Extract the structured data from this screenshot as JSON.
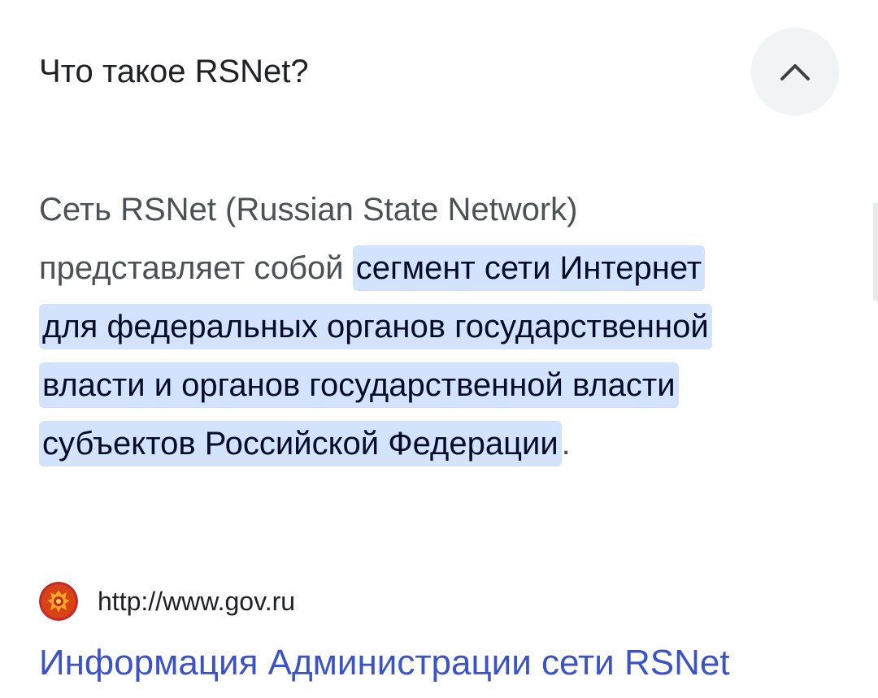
{
  "question": {
    "title": "Что такое RSNet?",
    "toggle_icon": "chevron-up-icon"
  },
  "answer": {
    "lead_text": "Сеть RSNet (Russian State Network) представляет собой ",
    "highlighted_text": "сегмент сети Интернет для федеральных органов государственной власти и органов государственной власти субъектов Российской Федерации",
    "trailing_text": "."
  },
  "source": {
    "favicon": "russian-coat-of-arms-icon",
    "url": "http://www.gov.ru"
  },
  "result": {
    "link_title": "Информация Администрации сети RSNet"
  },
  "colors": {
    "highlight_bg": "#d3e3fd",
    "link": "#3c53c8",
    "body_text": "#4d5156",
    "title_text": "#202124",
    "button_bg": "#f1f3f4"
  }
}
